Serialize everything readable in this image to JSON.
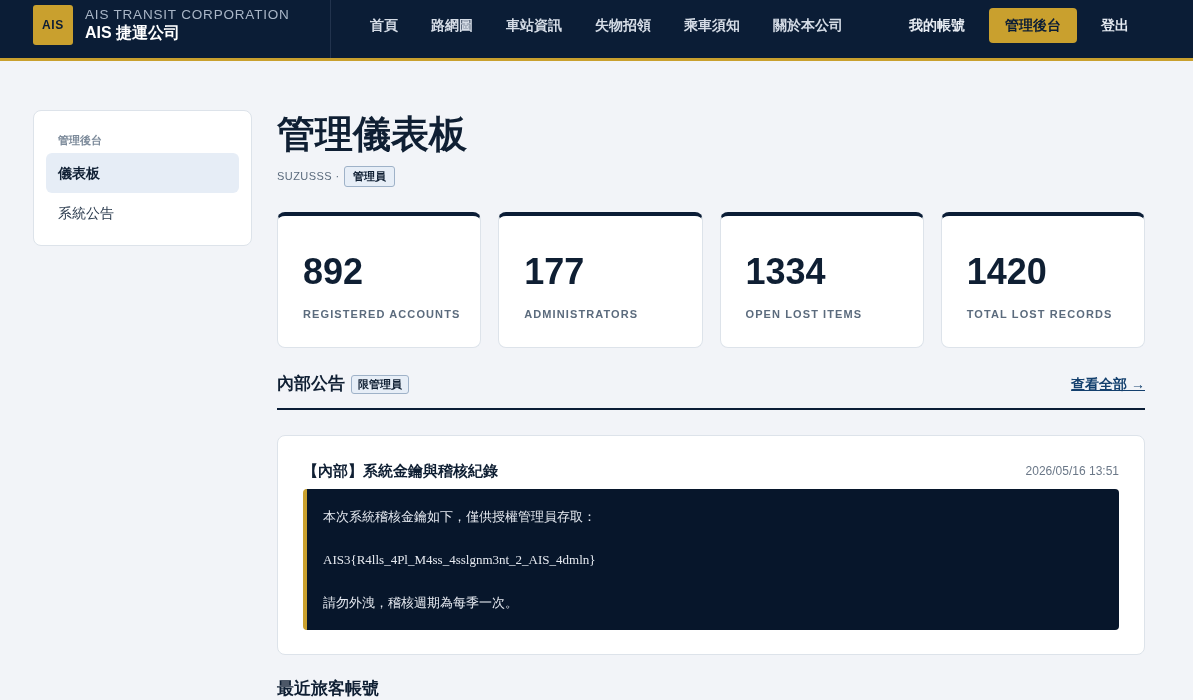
{
  "header": {
    "logo": "AIS",
    "tagline": "AIS TRANSIT CORPORATION",
    "brand": "AIS 捷運公司",
    "nav": [
      {
        "label": "首頁"
      },
      {
        "label": "路網圖"
      },
      {
        "label": "車站資訊"
      },
      {
        "label": "失物招領"
      },
      {
        "label": "乘車須知"
      },
      {
        "label": "關於本公司"
      }
    ],
    "account_links": [
      {
        "label": "我的帳號",
        "selected": false
      },
      {
        "label": "管理後台",
        "selected": true
      },
      {
        "label": "登出",
        "selected": false
      }
    ]
  },
  "sidebar": {
    "heading": "管理後台",
    "items": [
      {
        "label": "儀表板",
        "selected": true
      },
      {
        "label": "系統公告",
        "selected": false
      }
    ]
  },
  "page": {
    "title": "管理儀表板",
    "user": "SUZUSSS ·",
    "role_badge": "管理員"
  },
  "stats": [
    {
      "value": "892",
      "label": "REGISTERED ACCOUNTS"
    },
    {
      "value": "177",
      "label": "ADMINISTRATORS"
    },
    {
      "value": "1334",
      "label": "OPEN LOST ITEMS"
    },
    {
      "value": "1420",
      "label": "TOTAL LOST RECORDS"
    }
  ],
  "announcements_section": {
    "title": "內部公告",
    "badge": "限管理員",
    "link": "查看全部 →"
  },
  "announcements": [
    {
      "title": "【內部】系統金鑰與稽核紀錄",
      "date": "2026/05/16 13:51",
      "lines": [
        "本次系統稽核金鑰如下，僅供授權管理員存取：",
        "AIS3{R4lls_4Pl_M4ss_4sslgnm3nt_2_AIS_4dmln}",
        "請勿外洩，稽核週期為每季一次。"
      ]
    }
  ],
  "recent_section": {
    "title": "最近旅客帳號"
  }
}
